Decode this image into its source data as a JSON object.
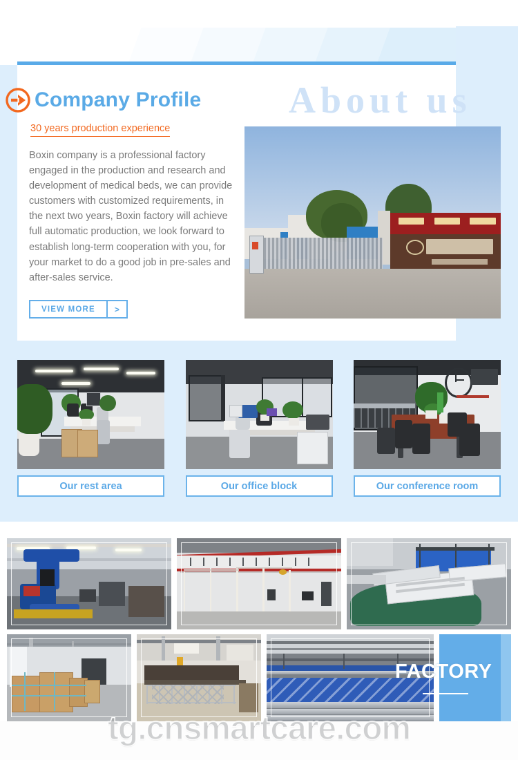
{
  "header": {
    "section_title": "Company Profile",
    "watermark_heading": "About us",
    "arrow_icon": "circle-arrow-right-icon"
  },
  "profile": {
    "tagline": "30 years production experience",
    "body": "Boxin company is a professional factory engaged in the production and research and development of medical beds, we can provide customers with customized requirements, in the next two years, Boxin factory will achieve full automatic production, we look forward to establish long-term cooperation with you, for your market to do a good job in pre-sales and after-sales service.",
    "view_more_label": "VIEW MORE",
    "view_more_arrow": ">"
  },
  "office_gallery": [
    {
      "caption": "Our rest area"
    },
    {
      "caption": "Our office block"
    },
    {
      "caption": "Our conference room"
    }
  ],
  "factory": {
    "label": "FACTORY"
  },
  "footer": {
    "watermark": "tg.cnsmartcare.com"
  },
  "colors": {
    "accent_blue": "#5aa8e6",
    "rule_blue": "#59aae8",
    "panel_blue": "#ddeefc",
    "accent_orange": "#f2681f",
    "about_us_blue": "#cfe2f7",
    "factory_panel_blue": "#63ade8"
  }
}
